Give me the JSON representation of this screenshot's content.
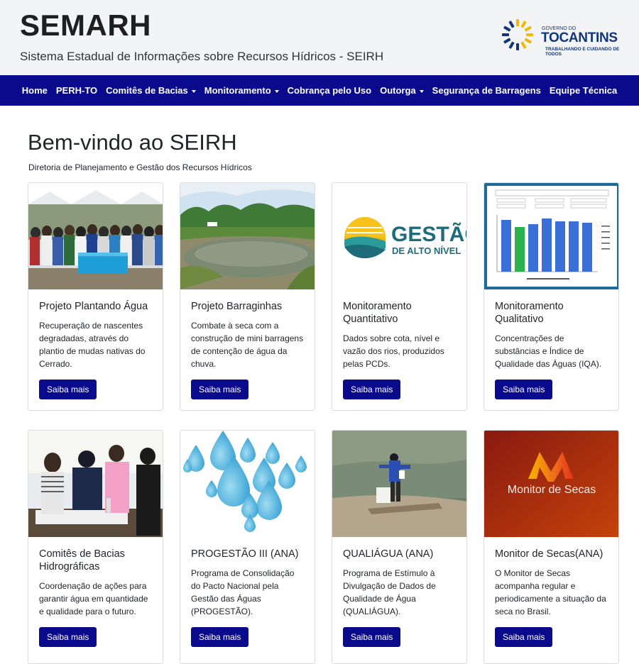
{
  "header": {
    "title": "SEMARH",
    "subtitle": "Sistema Estadual de Informações sobre Recursos Hídricos - SEIRH",
    "gov_logo": {
      "line1": "GOVERNO DO",
      "line2": "TOCANTINS",
      "line3": "TRABALHANDO E CUIDANDO DE TODOS",
      "icon": "sun-logo-icon",
      "colors": {
        "blue": "#12357a",
        "yellow": "#f2b705"
      }
    }
  },
  "nav": {
    "items": [
      {
        "label": "Home",
        "dropdown": false
      },
      {
        "label": "PERH-TO",
        "dropdown": false
      },
      {
        "label": "Comitês de Bacias",
        "dropdown": true
      },
      {
        "label": "Monitoramento",
        "dropdown": true
      },
      {
        "label": "Cobrança pelo Uso",
        "dropdown": false
      },
      {
        "label": "Outorga",
        "dropdown": true
      },
      {
        "label": "Segurança de Barragens",
        "dropdown": false
      },
      {
        "label": "Equipe Técnica",
        "dropdown": false
      }
    ],
    "color": "#0a0a8c"
  },
  "main": {
    "heading": "Bem-vindo ao SEIRH",
    "lead": "Diretoria de Planejamento e Gestão dos Recursos Hídricos",
    "button_label": "Saiba mais",
    "cards": [
      {
        "title": "Projeto Plantando Água",
        "text": "Recuperação de nascentes degradadas, através do plantio de mudas nativas do Cerrado.",
        "image": "group-photo"
      },
      {
        "title": "Projeto Barraginhas",
        "text": "Combate à seca com a construção de mini barragens de contenção de água da chuva.",
        "image": "pond-photo"
      },
      {
        "title": "Monitoramento Quantitativo",
        "text": "Dados sobre cota, nível e vazão dos rios, produzidos pelas PCDs.",
        "image": "gestao-logo",
        "logo_text_1": "GESTÃO",
        "logo_text_2": "DE ALTO NÍVEL"
      },
      {
        "title": "Monitoramento Qualitativo",
        "text": "Concentrações de substâncias e Índice de Qualidade das Águas (IQA).",
        "image": "bar-chart-screenshot"
      },
      {
        "title": "Comitês de Bacias Hidrográficas",
        "text": "Coordenação de ações para garantir água em quantidade e qualidade para o futuro.",
        "image": "people-photo"
      },
      {
        "title": "PROGESTÃO III (ANA)",
        "text": "Programa de Consolidação do Pacto Nacional pela Gestão das Águas (PROGESTÃO).",
        "image": "water-drops"
      },
      {
        "title": "QUALIÁGUA (ANA)",
        "text": "Programa de Estímulo à Divulgação de Dados de Qualidade de Água (QUALIÁGUA).",
        "image": "river-sampling-photo"
      },
      {
        "title": "Monitor de Secas(ANA)",
        "text": "O Monitor de Secas acompanha regular e periodicamente a situação da seca no Brasil.",
        "image": "monitor-secas-logo",
        "logo_text": "Monitor de Secas"
      }
    ]
  }
}
